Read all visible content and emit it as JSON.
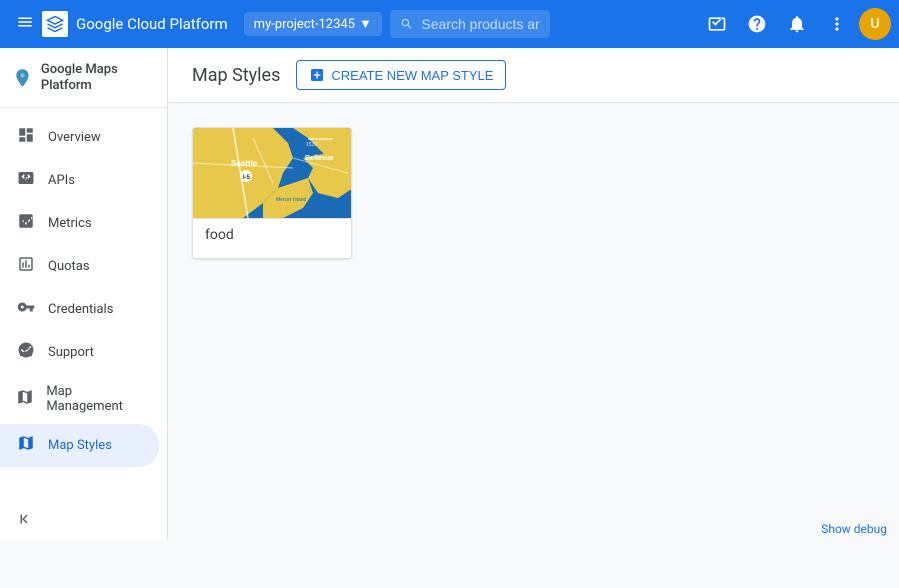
{
  "topbar": {
    "title": "Google Cloud Platform",
    "project_name": "my-project-12345",
    "search_placeholder": "Search products and resources",
    "menu_icon": "☰",
    "search_icon": "🔍",
    "dropdown_icon": "▼",
    "support_icon": "?",
    "notification_icon": "🔔",
    "more_icon": "⋮",
    "console_icon": "⬜"
  },
  "sidebar": {
    "brand": "Google Maps Platform",
    "items": [
      {
        "id": "overview",
        "label": "Overview",
        "icon": "⊞"
      },
      {
        "id": "apis",
        "label": "APIs",
        "icon": "⊞"
      },
      {
        "id": "metrics",
        "label": "Metrics",
        "icon": "📊"
      },
      {
        "id": "quotas",
        "label": "Quotas",
        "icon": "⬜"
      },
      {
        "id": "credentials",
        "label": "Credentials",
        "icon": "🔑"
      },
      {
        "id": "support",
        "label": "Support",
        "icon": "👤"
      },
      {
        "id": "map-management",
        "label": "Map Management",
        "icon": "⬜"
      },
      {
        "id": "map-styles",
        "label": "Map Styles",
        "icon": "◎",
        "active": true
      }
    ],
    "collapse_icon": "«"
  },
  "main": {
    "page_title": "Map Styles",
    "create_btn_label": "CREATE NEW MAP STYLE",
    "create_btn_icon": "+"
  },
  "map_cards": [
    {
      "id": "food",
      "label": "food"
    }
  ],
  "debug": {
    "label": "Show debug"
  }
}
